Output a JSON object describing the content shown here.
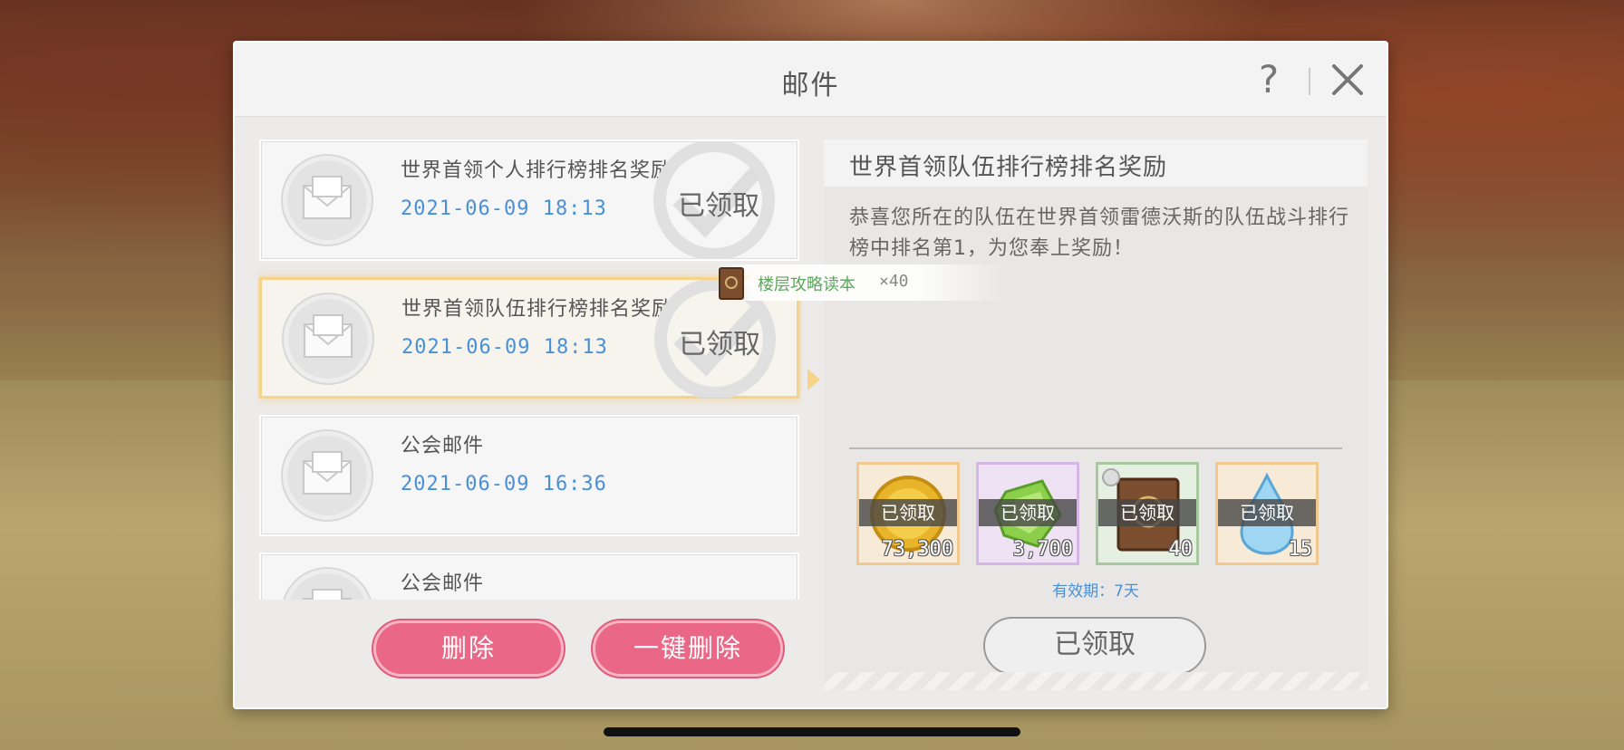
{
  "dialog": {
    "title": "邮件",
    "help_symbol": "?"
  },
  "mails": [
    {
      "title": "世界首领个人排行榜排名奖励",
      "date": "2021-06-09 18:13",
      "status": "已领取"
    },
    {
      "title": "世界首领队伍排行榜排名奖励",
      "date": "2021-06-09 18:13",
      "status": "已领取"
    },
    {
      "title": "公会邮件",
      "date": "2021-06-09 16:36",
      "status": ""
    },
    {
      "title": "公会邮件",
      "date": "",
      "status": ""
    }
  ],
  "buttons": {
    "delete": "删除",
    "delete_all": "一键删除",
    "claimed": "已领取"
  },
  "detail": {
    "title": "世界首领队伍排行榜排名奖励",
    "body": "恭喜您所在的队伍在世界首领雷德沃斯的队伍战斗排行榜中排名第1，为您奉上奖励！",
    "validity": "有效期：7天",
    "rewards": [
      {
        "icon": "gold-coin-icon",
        "label": "已领取",
        "count": "73,300"
      },
      {
        "icon": "green-crystal-icon",
        "label": "已领取",
        "count": "3,700"
      },
      {
        "icon": "strategy-book-icon",
        "label": "已领取",
        "count": "40"
      },
      {
        "icon": "water-drop-icon",
        "label": "已领取",
        "count": "15"
      }
    ]
  },
  "tooltip": {
    "item_name": "楼层攻略读本",
    "quantity": "×40"
  },
  "colors": {
    "accent_pink": "#ea6787",
    "date_blue": "#4a90d6",
    "tooltip_green": "#5aa85a"
  }
}
